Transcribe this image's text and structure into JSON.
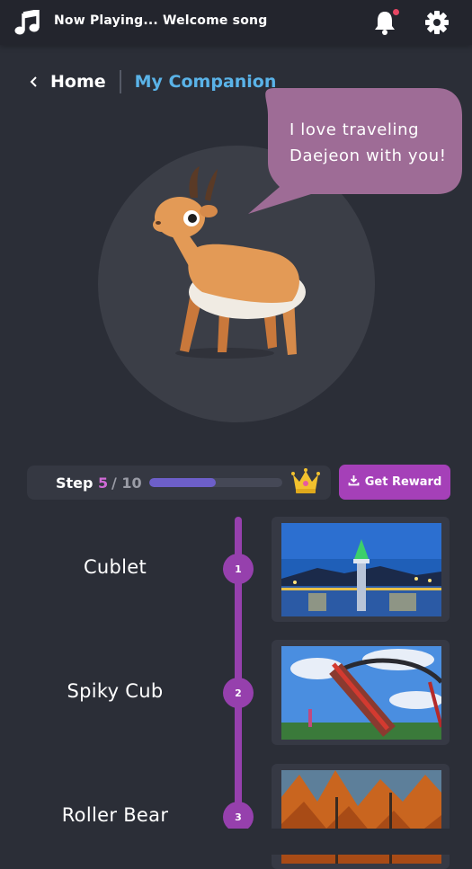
{
  "topbar": {
    "now_playing": "Now Playing... Welcome song",
    "icons": [
      "music-note-icon",
      "bell-icon",
      "gear-icon"
    ],
    "notification_dot_color": "#e64663"
  },
  "breadcrumb": {
    "home": "Home",
    "current": "My Companion"
  },
  "speech": {
    "line1": "I love traveling",
    "line2": "Daejeon with you!"
  },
  "step": {
    "label": "Step",
    "current": "5",
    "total_text": "/ 10",
    "progress_fraction": 0.5
  },
  "reward_button": {
    "label": "Get Reward"
  },
  "stages": [
    {
      "number": "1",
      "name": "Cublet"
    },
    {
      "number": "2",
      "name": "Spiky Cub"
    },
    {
      "number": "3",
      "name": "Roller Bear"
    }
  ],
  "colors": {
    "accent": "#a540b8",
    "link": "#5ab3e8",
    "progress": "#6d5fc9",
    "bubble": "#9e6c96"
  }
}
